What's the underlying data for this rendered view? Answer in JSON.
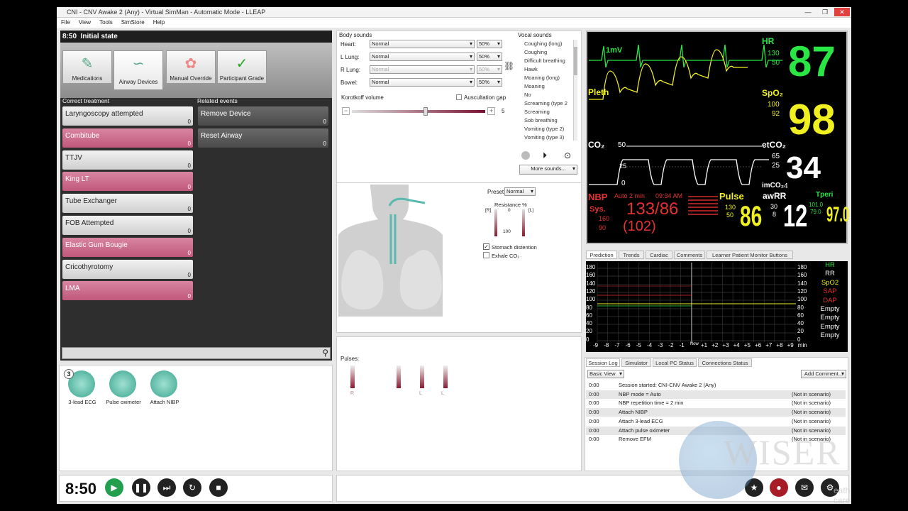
{
  "window": {
    "title": "CNI - CNV Awake 2 (Any) - Virtual SimMan - Automatic Mode - LLEAP",
    "controls": [
      "—",
      "❐",
      "✕"
    ]
  },
  "menu": [
    "File",
    "View",
    "Tools",
    "SimStore",
    "Help"
  ],
  "state": {
    "time": "8:50",
    "name": "Initial state"
  },
  "categories": [
    {
      "label": "Medications",
      "icon": "✎"
    },
    {
      "label": "Airway Devices",
      "icon": "∽"
    },
    {
      "label": "Manual Override",
      "icon": "✿"
    },
    {
      "label": "Participant Grade",
      "icon": "✓"
    }
  ],
  "correct_header": "Correct treatment",
  "related_header": "Related events",
  "treatments": [
    {
      "label": "Laryngoscopy attempted",
      "count": "0",
      "style": "gray"
    },
    {
      "label": "Combitube",
      "count": "0",
      "style": "pink"
    },
    {
      "label": "TTJV",
      "count": "0",
      "style": "gray"
    },
    {
      "label": "King LT",
      "count": "0",
      "style": "pink"
    },
    {
      "label": "Tube Exchanger",
      "count": "0",
      "style": "gray"
    },
    {
      "label": "FOB Attempted",
      "count": "0",
      "style": "gray"
    },
    {
      "label": "Elastic Gum Bougie",
      "count": "0",
      "style": "pink"
    },
    {
      "label": "Cricothyrotomy",
      "count": "0",
      "style": "gray"
    },
    {
      "label": "LMA",
      "count": "0",
      "style": "pink"
    }
  ],
  "related": [
    {
      "label": "Remove Device",
      "count": "0"
    },
    {
      "label": "Reset Airway",
      "count": "0"
    }
  ],
  "devices": [
    {
      "label": "3-lead ECG",
      "badge": "3"
    },
    {
      "label": "Pulse oximeter",
      "badge": ""
    },
    {
      "label": "Attach NIBP",
      "badge": ""
    }
  ],
  "body_sounds": {
    "title": "Body sounds",
    "rows": [
      {
        "label": "Heart:",
        "value": "Normal",
        "pct": "50%"
      },
      {
        "label": "L Lung:",
        "value": "Normal",
        "pct": "50%"
      },
      {
        "label": "R Lung:",
        "value": "Normal",
        "pct": "50%"
      },
      {
        "label": "Bowel:",
        "value": "Normal",
        "pct": "50%"
      }
    ],
    "korotkoff": "Korotkoff volume",
    "auscultation": "Auscultation gap",
    "volume_value": "5"
  },
  "vocal_sounds": {
    "title": "Vocal sounds",
    "items": [
      "Coughing (long)",
      "Coughing",
      "Difficult breathing",
      "Hawk",
      "Moaning (long)",
      "Moaning",
      "No",
      "Screaming (type 2",
      "Screaming",
      "Sob breathing",
      "Vomiting (type 2)",
      "Vomiting (type 3)"
    ],
    "more": "More sounds..."
  },
  "airway": {
    "preset_label": "Preset:",
    "preset_value": "Normal",
    "resistance_label": "Resistance %",
    "left_tag": "[R]",
    "right_tag": "[L]",
    "zero": "0",
    "hundred": "100",
    "stomach": "Stomach distention",
    "exhale": "Exhale CO₂"
  },
  "pulses": {
    "title": "Pulses:",
    "marks": [
      "R",
      "R",
      "L",
      "L"
    ]
  },
  "monitor": {
    "hr_label": "HR",
    "hr_hi": "130",
    "hr_lo": "50",
    "hr": "87",
    "mv": "1mV",
    "pleth": "Pleth",
    "spo2_label": "SpO₂",
    "spo2_hi": "100",
    "spo2_lo": "92",
    "spo2": "98",
    "co2": "CO₂",
    "co2_scale": "50",
    "co2_25": "25",
    "co2_0": "0",
    "etco2_label": "etCO₂",
    "etco2_hi": "65",
    "etco2_lo": "25",
    "etco2": "34",
    "imco2": "imCO₂",
    "imco2_val": "4",
    "nbp_label": "NBP",
    "nbp_mode": "Auto 2 min",
    "nbp_time": "09:34 AM",
    "sys_label": "Sys.",
    "sys_hi": "160",
    "sys_lo": "90",
    "nbp_val": "133/86",
    "nbp_mean": "(102)",
    "pulse_label": "Pulse",
    "pulse_hi": "130",
    "pulse_lo": "50",
    "pulse": "86",
    "awrr_label": "awRR",
    "awrr_hi": "30",
    "awrr_lo": "8",
    "awrr": "12",
    "tperi_label": "Tperi",
    "tperi_hi": "101.0",
    "tperi_lo": "79.0",
    "tperi": "97.0",
    "colors": {
      "hr": "#29e645",
      "spo2": "#f0f020",
      "nbp": "#e53030",
      "white": "#ffffff"
    }
  },
  "trend_tabs": [
    "Prediction",
    "Trends",
    "Cardiac",
    "Comments",
    "Learner Patient Monitor Buttons"
  ],
  "trend": {
    "yticks": [
      "180",
      "160",
      "140",
      "120",
      "100",
      "80",
      "60",
      "40",
      "20",
      "0"
    ],
    "xticks": [
      "-9",
      "-8",
      "-7",
      "-6",
      "-5",
      "-4",
      "-3",
      "-2",
      "-1",
      "Now",
      "+1",
      "+2",
      "+3",
      "+4",
      "+5",
      "+6",
      "+7",
      "+8",
      "+9",
      "min"
    ],
    "legend": [
      "HR",
      "RR",
      "SpO2",
      "SAP",
      "DAP",
      "Empty",
      "Empty",
      "Empty",
      "Empty"
    ],
    "legend_colors": [
      "#29e645",
      "#ffffff",
      "#f0f020",
      "#e53030",
      "#e53030",
      "#ffffff",
      "#ffffff",
      "#ffffff",
      "#ffffff"
    ]
  },
  "log_tabs": [
    "Session Log",
    "Simulator",
    "Local PC Status",
    "Connections Status"
  ],
  "log_view": "Basic View",
  "add_comment": "Add Comment...",
  "log": [
    {
      "t": "0:00",
      "msg": "Session started: CNI-CNV Awake 2 (Any)",
      "note": ""
    },
    {
      "t": "0:00",
      "msg": "NBP mode = Auto",
      "note": "(Not in scenario)"
    },
    {
      "t": "0:00",
      "msg": "NBP repetition time = 2 min",
      "note": "(Not in scenario)"
    },
    {
      "t": "0:00",
      "msg": "Attach NIBP",
      "note": "(Not in scenario)"
    },
    {
      "t": "0:00",
      "msg": "Attach 3-lead ECG",
      "note": "(Not in scenario)"
    },
    {
      "t": "0:00",
      "msg": "Attach pulse oximeter",
      "note": "(Not in scenario)"
    },
    {
      "t": "0:00",
      "msg": "Remove EFM",
      "note": "(Not in scenario)"
    }
  ],
  "clock": "8:50",
  "watermark": {
    "letters": "WISER",
    "line1": "lation",
    "line2": "eath care"
  }
}
